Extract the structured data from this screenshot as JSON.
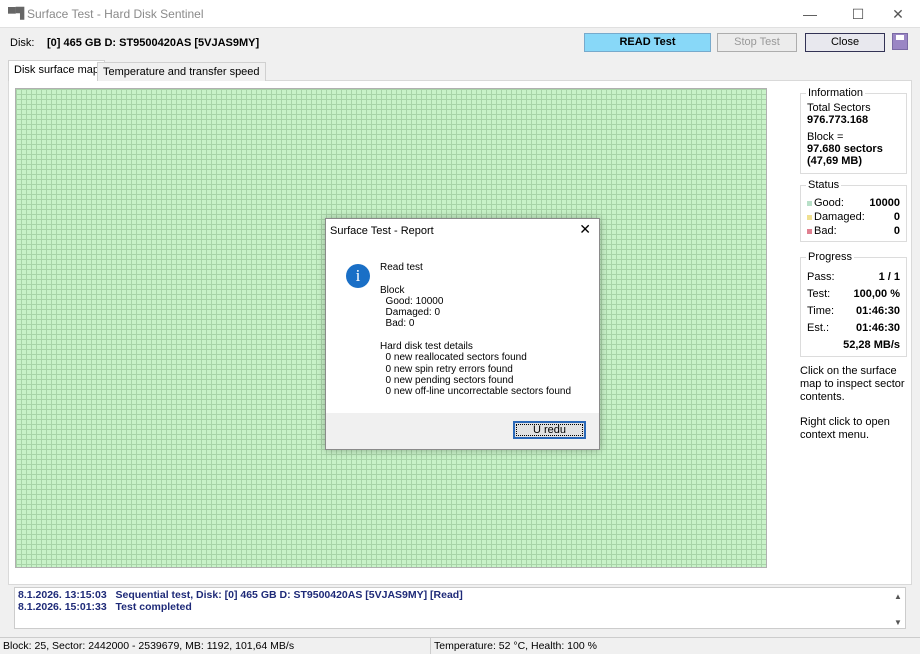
{
  "window": {
    "title": "Surface Test - Hard Disk Sentinel"
  },
  "disk": {
    "label": "Disk:",
    "value": "[0] 465 GB D: ST9500420AS [5VJAS9MY]"
  },
  "toolbar": {
    "read": "READ Test",
    "stop": "Stop Test",
    "close": "Close"
  },
  "tabs": [
    {
      "label": "Disk surface map",
      "active": true
    },
    {
      "label": "Temperature and transfer speed",
      "active": false
    }
  ],
  "map": {
    "good_color": "#c8f2c8",
    "blocks_good": 10000
  },
  "information": {
    "title": "Information",
    "total_label": "Total Sectors",
    "total": "976.773.168",
    "block_label": "Block =",
    "block_sectors": "97.680 sectors",
    "block_mb": "(47,69 MB)"
  },
  "status_group": {
    "title": "Status",
    "good_label": "Good:",
    "good": "10000",
    "damaged_label": "Damaged:",
    "damaged": "0",
    "bad_label": "Bad:",
    "bad": "0",
    "good_color": "#b8e0c8",
    "damaged_color": "#f0e090",
    "bad_color": "#e08090"
  },
  "progress": {
    "title": "Progress",
    "pass_label": "Pass:",
    "pass": "1 / 1",
    "test_label": "Test:",
    "test": "100,00 %",
    "time_label": "Time:",
    "time": "01:46:30",
    "est_label": "Est.:",
    "est": "01:46:30",
    "speed": "52,28 MB/s"
  },
  "notes": {
    "click": "Click on the surface map to inspect sector contents.",
    "right": "Right click to open context menu."
  },
  "dialog": {
    "title": "Surface Test - Report",
    "body": "Read test\n\nBlock\n  Good: 10000\n  Damaged: 0\n  Bad: 0\n\nHard disk test details\n  0 new reallocated sectors found\n  0 new spin retry errors found\n  0 new pending sectors found\n  0 new off-line uncorrectable sectors found",
    "ok": "U redu"
  },
  "log": [
    {
      "time": "8.1.2026.  13:15:03",
      "text": "Sequential test, Disk: [0] 465 GB D: ST9500420AS [5VJAS9MY] [Read]"
    },
    {
      "time": "8.1.2026.  15:01:33",
      "text": "Test completed"
    }
  ],
  "statusbar": {
    "left": "Block: 25, Sector: 2442000 - 2539679, MB: 1192, 101,64 MB/s",
    "right": "Temperature: 52  °C,  Health: 100 %"
  }
}
